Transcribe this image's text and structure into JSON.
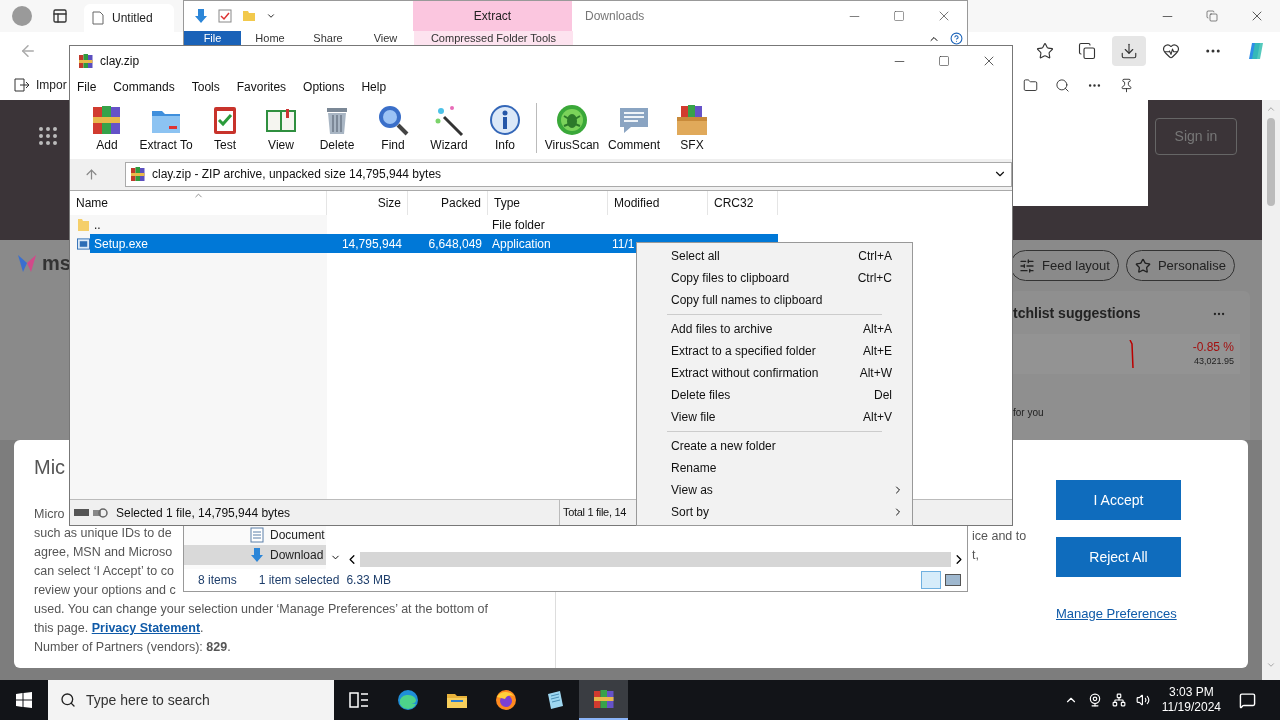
{
  "browser": {
    "tab_title": "Untitled",
    "favorites_item": "Impor",
    "sign_in": "Sign in",
    "logo_text": "ms",
    "feed_buttons": [
      {
        "label": "Feed layout",
        "kind": "layout"
      },
      {
        "label": "Personalise",
        "kind": "personalise"
      }
    ],
    "watchlist": {
      "title": "tchlist suggestions",
      "change": "-0.85 %",
      "value": "43,021.95",
      "footer": "for you"
    }
  },
  "consent": {
    "title": "Mic",
    "lines": [
      "Micro",
      "such as unique IDs to de",
      "agree, MSN and Microso",
      "can select ‘I Accept’ to co",
      "review your options and c",
      "used.  You can change your selection under ‘Manage Preferences’ at the bottom of"
    ],
    "privacy": {
      "before": "this page.",
      "link": "Privacy Statement",
      "after": "."
    },
    "partners": "Number of Partners (vendors): **829**.",
    "fragments": [
      "ice and to",
      "t,"
    ],
    "buttons": [
      "I Accept",
      "Reject All"
    ],
    "manage_link": "Manage Preferences"
  },
  "explorer": {
    "title": "Downloads",
    "context_tab": "Extract",
    "ribbon_tabs": [
      {
        "label": "File",
        "kind": "file"
      },
      {
        "label": "Home",
        "kind": "tab"
      },
      {
        "label": "Share",
        "kind": "tab"
      },
      {
        "label": "View",
        "kind": "tab"
      },
      {
        "label": "Compressed Folder Tools",
        "kind": "context"
      }
    ],
    "nav_items": [
      {
        "label": "Document",
        "kind": "documents",
        "selected": false
      },
      {
        "label": "Download",
        "kind": "downloads",
        "selected": true
      }
    ],
    "status": {
      "count": "8 items",
      "selection": "1 item selected",
      "size": "6.33 MB"
    }
  },
  "winrar": {
    "title": "clay.zip",
    "menu": [
      "File",
      "Commands",
      "Tools",
      "Favorites",
      "Options",
      "Help"
    ],
    "toolbar": [
      {
        "label": "Add",
        "kind": "add"
      },
      {
        "label": "Extract To",
        "kind": "extract"
      },
      {
        "label": "Test",
        "kind": "test"
      },
      {
        "label": "View",
        "kind": "view"
      },
      {
        "label": "Delete",
        "kind": "delete"
      },
      {
        "label": "Find",
        "kind": "find"
      },
      {
        "label": "Wizard",
        "kind": "wizard"
      },
      {
        "label": "Info",
        "kind": "info"
      },
      {
        "label": "VirusScan",
        "kind": "virusscan"
      },
      {
        "label": "Comment",
        "kind": "comment"
      },
      {
        "label": "SFX",
        "kind": "sfx"
      }
    ],
    "address": "clay.zip - ZIP archive, unpacked size 14,795,944 bytes",
    "columns": [
      "Name",
      "Size",
      "Packed",
      "Type",
      "Modified",
      "CRC32"
    ],
    "rows": [
      {
        "kind": "folder",
        "selected": false,
        "cells": {
          "name": "..",
          "type": "File folder"
        }
      },
      {
        "kind": "file",
        "selected": true,
        "cells": {
          "name": "Setup.exe",
          "size": "14,795,944",
          "packed": "6,648,049",
          "type": "Application",
          "modified": "11/1"
        }
      }
    ],
    "status": [
      "Selected 1 file, 14,795,944 bytes",
      "Total 1 file, 14"
    ]
  },
  "context_menu": [
    {
      "kind": "item",
      "label": "Select all",
      "shortcut": "Ctrl+A"
    },
    {
      "kind": "item",
      "label": "Copy files to clipboard",
      "shortcut": "Ctrl+C"
    },
    {
      "kind": "item",
      "label": "Copy full names to clipboard"
    },
    {
      "kind": "separator"
    },
    {
      "kind": "item",
      "label": "Add files to archive",
      "shortcut": "Alt+A"
    },
    {
      "kind": "item",
      "label": "Extract to a specified folder",
      "shortcut": "Alt+E"
    },
    {
      "kind": "item",
      "label": "Extract without confirmation",
      "shortcut": "Alt+W"
    },
    {
      "kind": "item",
      "label": "Delete files",
      "shortcut": "Del"
    },
    {
      "kind": "item",
      "label": "View file",
      "shortcut": "Alt+V"
    },
    {
      "kind": "separator"
    },
    {
      "kind": "item",
      "label": "Create a new folder"
    },
    {
      "kind": "item",
      "label": "Rename"
    },
    {
      "kind": "submenu",
      "label": "View as"
    },
    {
      "kind": "submenu",
      "label": "Sort by"
    }
  ],
  "taskbar": {
    "search_placeholder": "Type here to search",
    "apps": [
      {
        "kind": "task_view",
        "active": false
      },
      {
        "kind": "edge",
        "active": false
      },
      {
        "kind": "explorer",
        "active": false
      },
      {
        "kind": "firefox",
        "active": false
      },
      {
        "kind": "notepad",
        "active": false
      },
      {
        "kind": "winrar",
        "active": true
      }
    ],
    "time": "3:03 PM",
    "date": "11/19/2024"
  }
}
